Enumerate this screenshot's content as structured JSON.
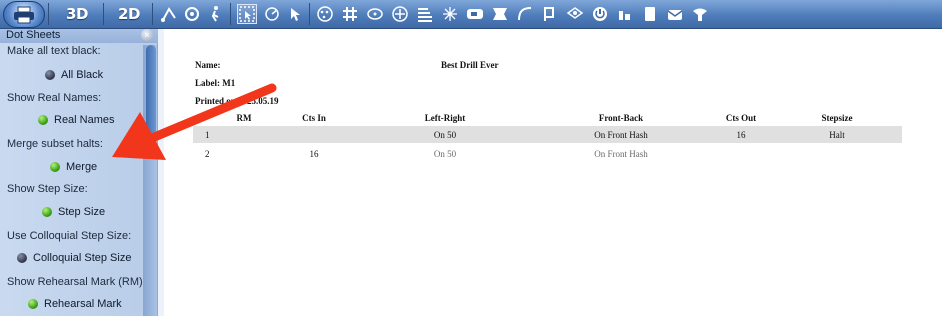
{
  "toolbar": {
    "label_3d": "3D",
    "label_2d": "2D",
    "icons": [
      "printer-icon",
      "draw-path-icon",
      "camera-icon",
      "marcher-icon",
      "select-box-icon",
      "radar-icon",
      "pointer-icon",
      "copy-tool-icon",
      "grid-icon",
      "shape-tool-icon",
      "reflect-icon",
      "text-align-icon",
      "burst-icon",
      "keyboard-icon",
      "fold-icon",
      "curve-icon",
      "flag-icon",
      "layers-icon",
      "power-icon",
      "tools-icon",
      "page-icon",
      "mailbox-icon",
      "balloon-icon"
    ]
  },
  "sidebar": {
    "title": "Dot Sheets",
    "close": "×",
    "sections": [
      {
        "label": "Make all text black:",
        "option": "All Black",
        "selected": false
      },
      {
        "label": "Show Real Names:",
        "option": "Real Names",
        "selected": true
      },
      {
        "label": "Merge subset halts:",
        "option": "Merge",
        "selected": true
      },
      {
        "label": "Show Step Size:",
        "option": "Step Size",
        "selected": true
      },
      {
        "label": "Use Colloquial Step Size:",
        "option": "Colloquial Step Size",
        "selected": false
      },
      {
        "label": "Show Rehearsal Mark (RM):",
        "option": "Rehearsal Mark",
        "selected": true
      }
    ]
  },
  "document": {
    "name_label": "Name:",
    "name_value": "Best Drill Ever",
    "label_line": "Label: M1",
    "printed_line": "Printed on 2025.05.19",
    "columns": [
      "RM",
      "Cts In",
      "Left-Right",
      "Front-Back",
      "Cts Out",
      "Stepsize"
    ],
    "rows": [
      {
        "num": "1",
        "rm": "",
        "cts_in": "",
        "left_right": "On 50",
        "front_back": "On Front Hash",
        "cts_out": "16",
        "stepsize": "Halt"
      },
      {
        "num": "2",
        "rm": "",
        "cts_in": "16",
        "left_right": "On 50",
        "front_back": "On Front Hash",
        "cts_out": "",
        "stepsize": ""
      }
    ]
  },
  "annotation": {
    "arrow_color": "#f2361b"
  }
}
